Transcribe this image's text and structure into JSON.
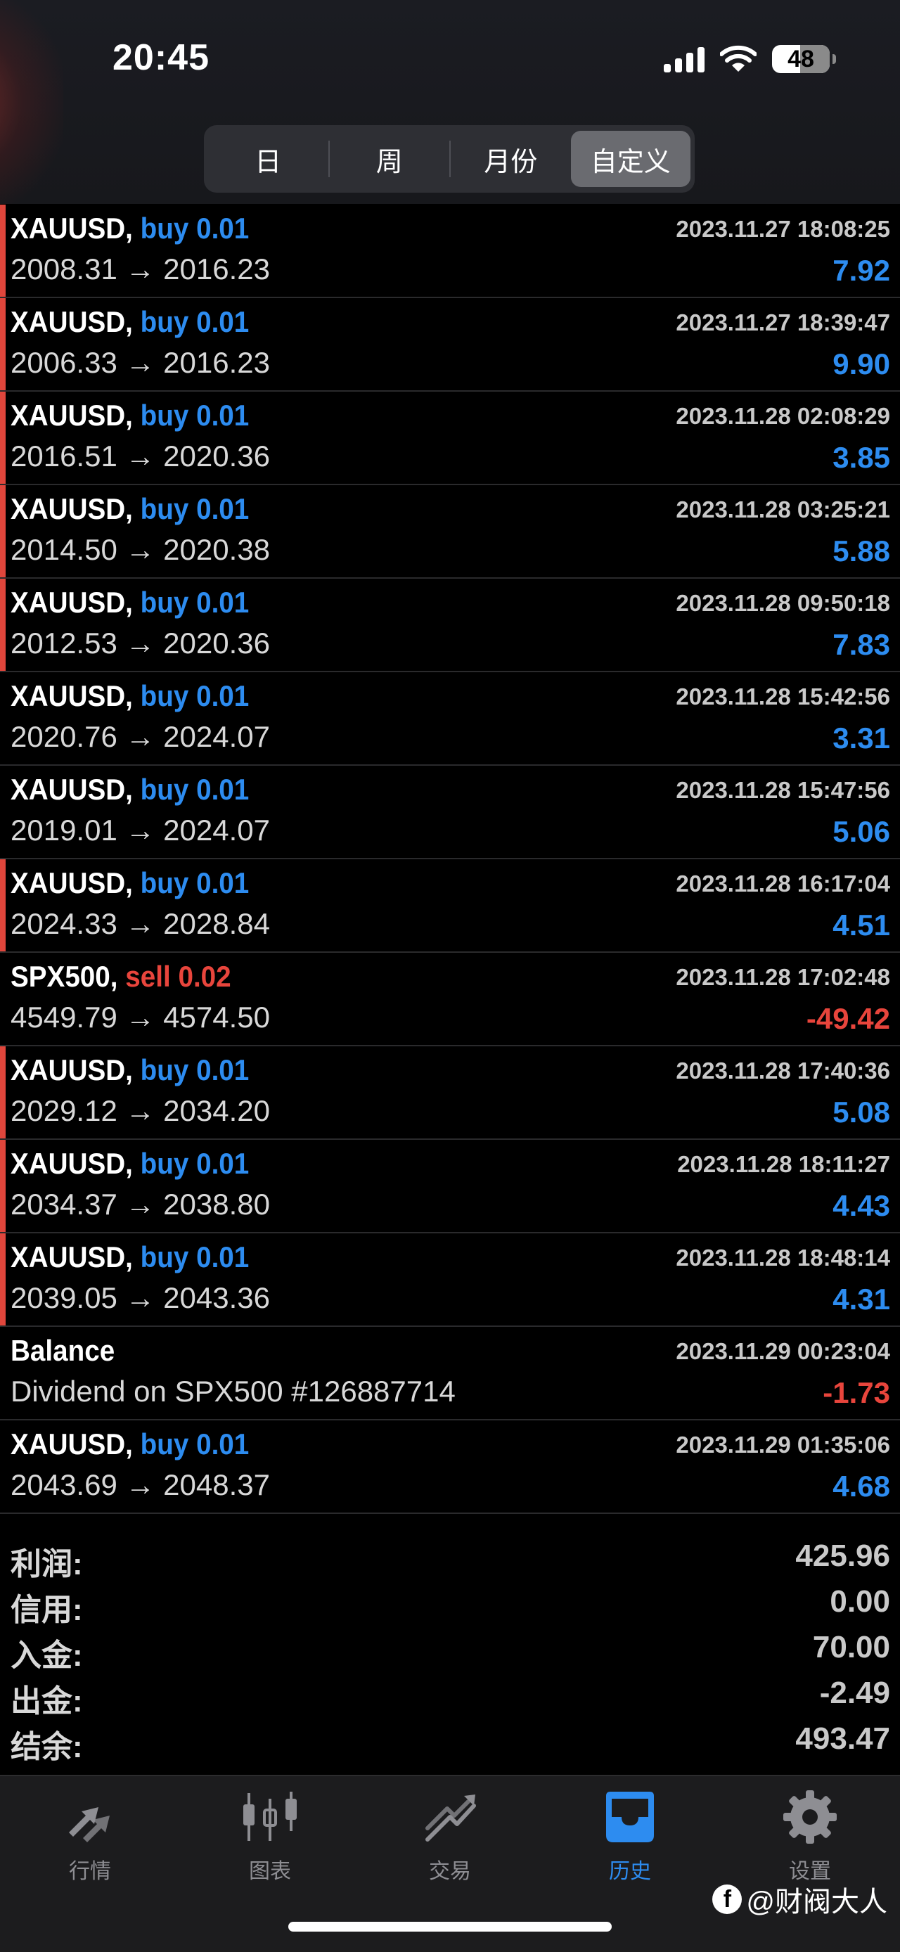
{
  "status_bar": {
    "time": "20:45",
    "battery": "48"
  },
  "period_tabs": [
    {
      "label": "日",
      "active": false
    },
    {
      "label": "周",
      "active": false
    },
    {
      "label": "月份",
      "active": false
    },
    {
      "label": "自定义",
      "active": true
    }
  ],
  "deals": [
    {
      "symbol": "XAUUSD,",
      "side": "buy 0.01",
      "type": "buy",
      "prices": "2008.31 → 2016.23",
      "datetime": "2023.11.27 18:08:25",
      "profit": "7.92",
      "flag": true
    },
    {
      "symbol": "XAUUSD,",
      "side": "buy 0.01",
      "type": "buy",
      "prices": "2006.33 → 2016.23",
      "datetime": "2023.11.27 18:39:47",
      "profit": "9.90",
      "flag": true
    },
    {
      "symbol": "XAUUSD,",
      "side": "buy 0.01",
      "type": "buy",
      "prices": "2016.51 → 2020.36",
      "datetime": "2023.11.28 02:08:29",
      "profit": "3.85",
      "flag": true
    },
    {
      "symbol": "XAUUSD,",
      "side": "buy 0.01",
      "type": "buy",
      "prices": "2014.50 → 2020.38",
      "datetime": "2023.11.28 03:25:21",
      "profit": "5.88",
      "flag": true
    },
    {
      "symbol": "XAUUSD,",
      "side": "buy 0.01",
      "type": "buy",
      "prices": "2012.53 → 2020.36",
      "datetime": "2023.11.28 09:50:18",
      "profit": "7.83",
      "flag": true
    },
    {
      "symbol": "XAUUSD,",
      "side": "buy 0.01",
      "type": "buy",
      "prices": "2020.76 → 2024.07",
      "datetime": "2023.11.28 15:42:56",
      "profit": "3.31",
      "flag": false
    },
    {
      "symbol": "XAUUSD,",
      "side": "buy 0.01",
      "type": "buy",
      "prices": "2019.01 → 2024.07",
      "datetime": "2023.11.28 15:47:56",
      "profit": "5.06",
      "flag": false
    },
    {
      "symbol": "XAUUSD,",
      "side": "buy 0.01",
      "type": "buy",
      "prices": "2024.33 → 2028.84",
      "datetime": "2023.11.28 16:17:04",
      "profit": "4.51",
      "flag": true
    },
    {
      "symbol": "SPX500,",
      "side": "sell 0.02",
      "type": "sell",
      "prices": "4549.79 → 4574.50",
      "datetime": "2023.11.28 17:02:48",
      "profit": "-49.42",
      "flag": false
    },
    {
      "symbol": "XAUUSD,",
      "side": "buy 0.01",
      "type": "buy",
      "prices": "2029.12 → 2034.20",
      "datetime": "2023.11.28 17:40:36",
      "profit": "5.08",
      "flag": true
    },
    {
      "symbol": "XAUUSD,",
      "side": "buy 0.01",
      "type": "buy",
      "prices": "2034.37 → 2038.80",
      "datetime": "2023.11.28 18:11:27",
      "profit": "4.43",
      "flag": true
    },
    {
      "symbol": "XAUUSD,",
      "side": "buy 0.01",
      "type": "buy",
      "prices": "2039.05 → 2043.36",
      "datetime": "2023.11.28 18:48:14",
      "profit": "4.31",
      "flag": true
    },
    {
      "symbol": "Balance",
      "side": "",
      "type": "balance",
      "prices": "Dividend on SPX500 #126887714",
      "datetime": "2023.11.29 00:23:04",
      "profit": "-1.73",
      "flag": false
    },
    {
      "symbol": "XAUUSD,",
      "side": "buy 0.01",
      "type": "buy",
      "prices": "2043.69 → 2048.37",
      "datetime": "2023.11.29 01:35:06",
      "profit": "4.68",
      "flag": false
    }
  ],
  "summary": [
    {
      "label": "利润:",
      "value": "425.96"
    },
    {
      "label": "信用:",
      "value": "0.00"
    },
    {
      "label": "入金:",
      "value": "70.00"
    },
    {
      "label": "出金:",
      "value": "-2.49"
    },
    {
      "label": "结余:",
      "value": "493.47"
    }
  ],
  "tabbar": [
    {
      "label": "行情",
      "icon": "quotes-icon",
      "active": false
    },
    {
      "label": "图表",
      "icon": "chart-icon",
      "active": false
    },
    {
      "label": "交易",
      "icon": "trade-icon",
      "active": false
    },
    {
      "label": "历史",
      "icon": "history-icon",
      "active": true
    },
    {
      "label": "设置",
      "icon": "gear-icon",
      "active": false
    }
  ],
  "watermark": "@财阀大人",
  "colors": {
    "buy": "#2d8cf0",
    "sell": "#e8453c",
    "flag": "#e0463c",
    "active_tab": "#2d8cf0"
  }
}
